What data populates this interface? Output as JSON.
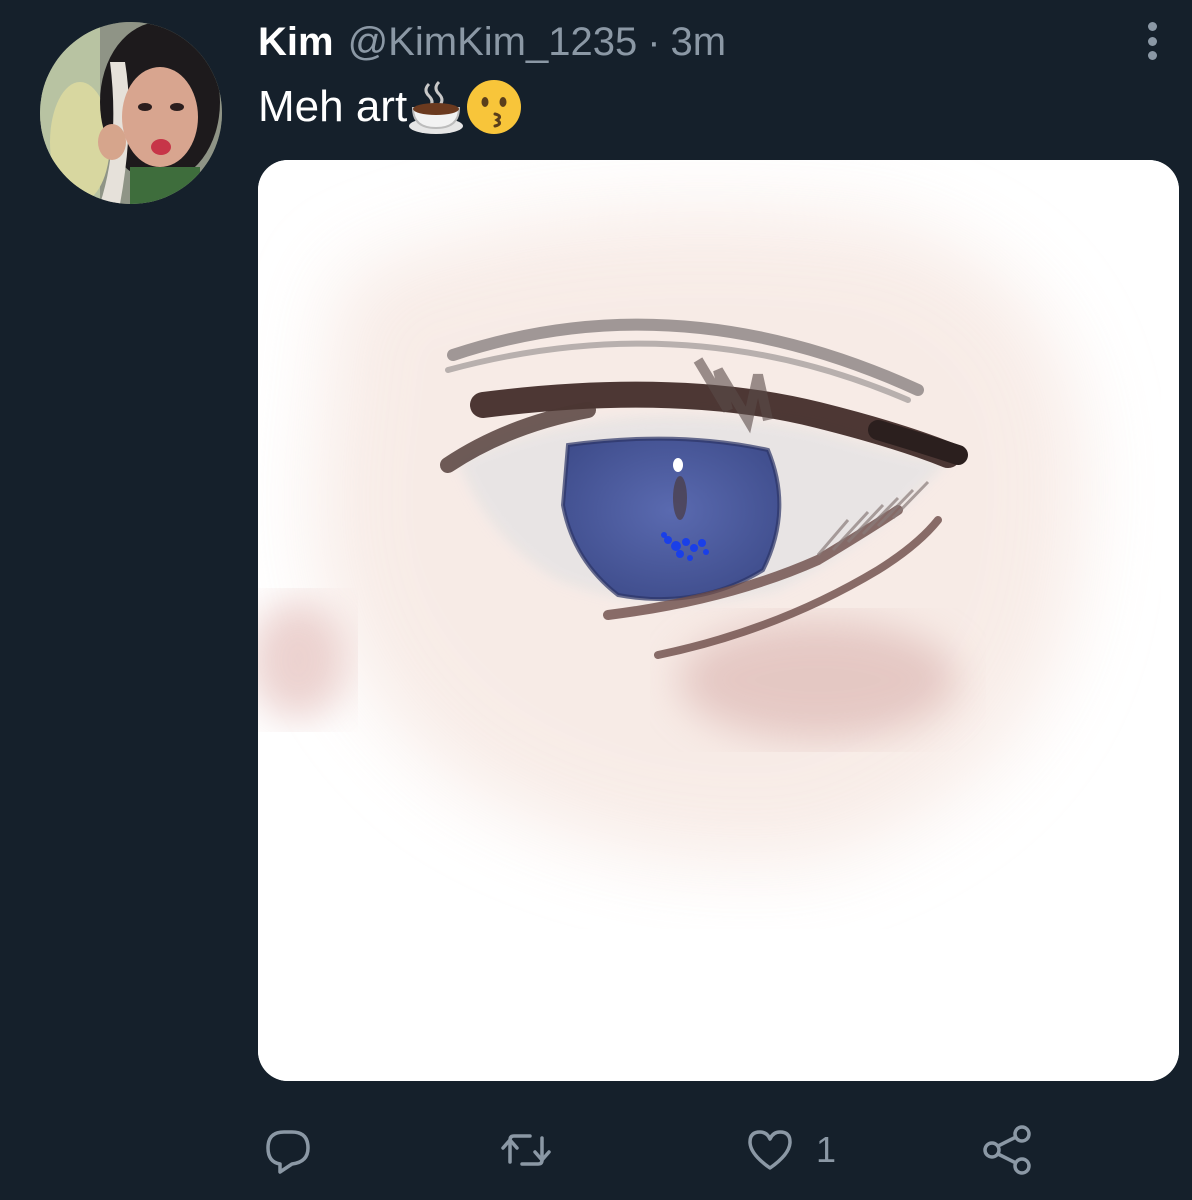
{
  "tweet": {
    "display_name": "Kim",
    "handle": "@KimKim_1235",
    "separator": "·",
    "time": "3m",
    "text": "Meh art",
    "emojis": [
      "hot-beverage-emoji",
      "kissing-face-emoji"
    ]
  },
  "actions": {
    "reply_icon": "reply-icon",
    "retweet_icon": "retweet-icon",
    "like_icon": "heart-icon",
    "like_count": "1",
    "share_icon": "share-icon"
  },
  "colors": {
    "background": "#15202b",
    "text_primary": "#ffffff",
    "text_secondary": "#8b98a5",
    "iris": "#4a5a98",
    "iris_sparkle": "#1a3fe8"
  }
}
